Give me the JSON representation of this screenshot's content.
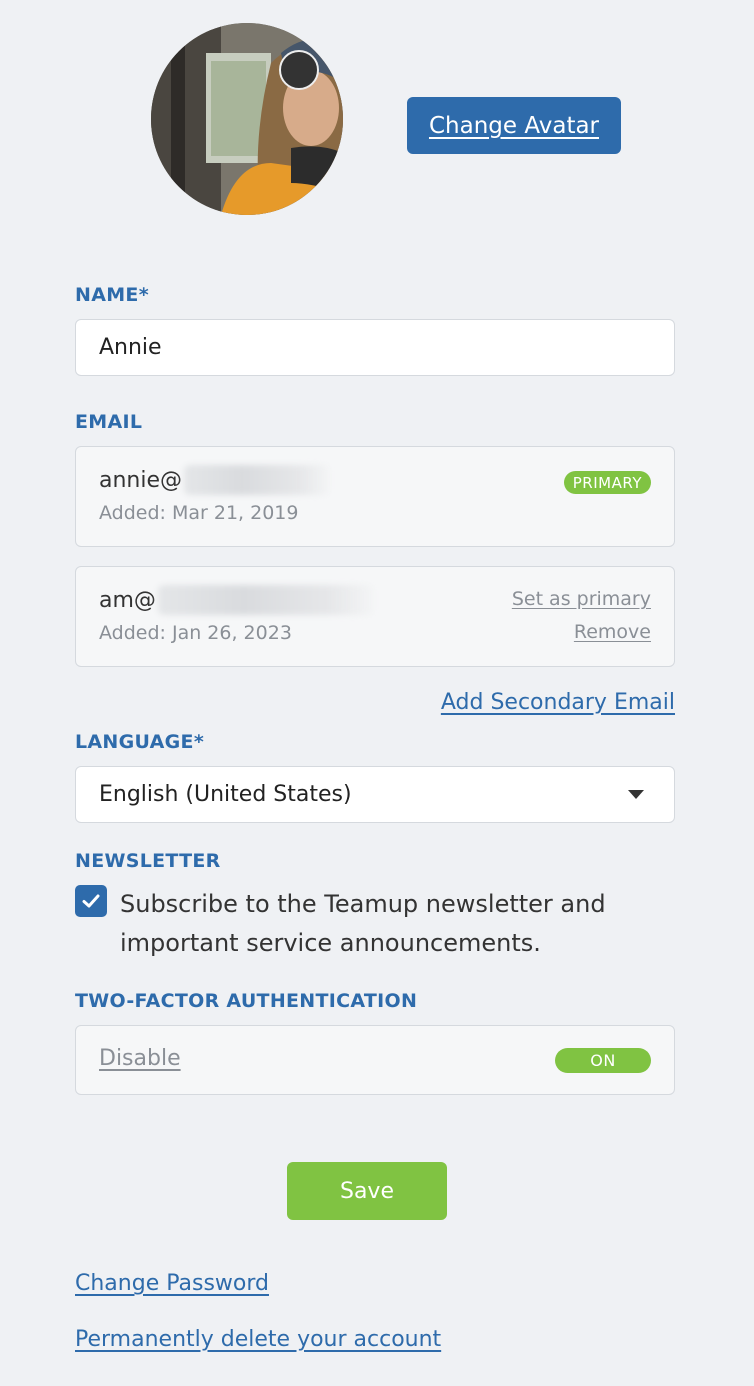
{
  "avatar": {
    "change_label": "Change Avatar"
  },
  "name": {
    "label": "NAME*",
    "value": "Annie"
  },
  "email": {
    "label": "EMAIL",
    "entries": [
      {
        "address": "annie@",
        "added": "Added: Mar 21, 2019",
        "badge": "PRIMARY"
      },
      {
        "address": "am@",
        "added": "Added: Jan 26, 2023",
        "set_primary": "Set as primary",
        "remove": "Remove"
      }
    ],
    "add_secondary": "Add Secondary Email"
  },
  "language": {
    "label": "LANGUAGE*",
    "value": "English (United States)"
  },
  "newsletter": {
    "label": "NEWSLETTER",
    "checked": true,
    "text": "Subscribe to the Teamup newsletter and important service announcements."
  },
  "two_factor": {
    "label": "TWO-FACTOR AUTHENTICATION",
    "disable": "Disable",
    "toggle": "ON"
  },
  "save_label": "Save",
  "links": {
    "change_password": "Change Password",
    "delete_account": "Permanently delete your account"
  },
  "colors": {
    "accent": "#2e6bab",
    "success": "#80c342",
    "background": "#eff1f4"
  }
}
